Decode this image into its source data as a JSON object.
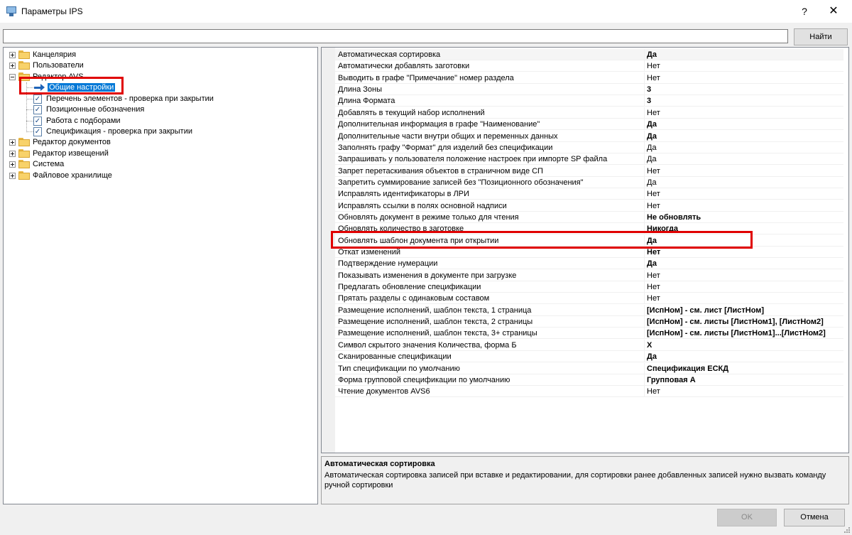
{
  "window": {
    "title": "Параметры IPS",
    "help_label": "?",
    "close_label": "✕"
  },
  "search": {
    "value": "",
    "placeholder": "",
    "button_label": "Найти"
  },
  "tree": {
    "items": [
      {
        "label": "Канцелярия",
        "icon": "folder-icon"
      },
      {
        "label": "Пользователи",
        "icon": "folder-icon"
      },
      {
        "label": "Редактор AVS",
        "icon": "folder-icon"
      },
      {
        "label": "Общие настройки",
        "icon": "arrow-right-icon",
        "selected": true
      },
      {
        "label": "Перечень элементов - проверка при закрытии",
        "icon": "checklist-icon"
      },
      {
        "label": "Позиционные обозначения",
        "icon": "checklist-icon"
      },
      {
        "label": "Работа с подборами",
        "icon": "checklist-icon"
      },
      {
        "label": "Спецификация - проверка при закрытии",
        "icon": "checklist-icon"
      },
      {
        "label": "Редактор документов",
        "icon": "folder-icon"
      },
      {
        "label": "Редактор извещений",
        "icon": "folder-icon"
      },
      {
        "label": "Система",
        "icon": "folder-icon"
      },
      {
        "label": "Файловое хранилище",
        "icon": "folder-icon"
      }
    ]
  },
  "grid": {
    "rows": [
      {
        "name": "Автоматическая сортировка",
        "value": "Да"
      },
      {
        "name": "Автоматически добавлять заготовки",
        "value": "Нет"
      },
      {
        "name": "Выводить в графе \"Примечание\" номер раздела",
        "value": "Нет"
      },
      {
        "name": "Длина Зоны",
        "value": "3"
      },
      {
        "name": "Длина Формата",
        "value": "3"
      },
      {
        "name": "Добавлять в текущий набор исполнений",
        "value": "Нет"
      },
      {
        "name": "Дополнительная информация в графе \"Наименование\"",
        "value": "Да"
      },
      {
        "name": "Дополнительные части внутри общих и переменных данных",
        "value": "Да"
      },
      {
        "name": "Заполнять графу \"Формат\" для изделий без спецификации",
        "value": "Да"
      },
      {
        "name": "Запрашивать у пользователя положение настроек при импорте SP файла",
        "value": "Да"
      },
      {
        "name": "Запрет перетаскивания объектов в страничном виде СП",
        "value": "Нет"
      },
      {
        "name": "Запретить суммирование записей без \"Позиционного обозначения\"",
        "value": "Да"
      },
      {
        "name": "Исправлять идентификаторы в ЛРИ",
        "value": "Нет"
      },
      {
        "name": "Исправлять ссылки в полях основной надписи",
        "value": "Нет"
      },
      {
        "name": "Обновлять документ в режиме только для чтения",
        "value": "Не обновлять"
      },
      {
        "name": "Обновлять количество в заготовке",
        "value": "Никогда"
      },
      {
        "name": "Обновлять шаблон документа при открытии",
        "value": "Да"
      },
      {
        "name": "Откат изменений",
        "value": "Нет"
      },
      {
        "name": "Подтверждение нумерации",
        "value": "Да"
      },
      {
        "name": "Показывать изменения в документе при загрузке",
        "value": "Нет"
      },
      {
        "name": "Предлагать обновление спецификации",
        "value": "Нет"
      },
      {
        "name": "Прятать разделы с одинаковым составом",
        "value": "Нет"
      },
      {
        "name": "Размещение исполнений, шаблон текста, 1 страница",
        "value": "[ИспНом] - см. лист [ЛистНом]"
      },
      {
        "name": "Размещение исполнений, шаблон текста, 2 страницы",
        "value": "[ИспНом] - см. листы [ЛистНом1], [ЛистНом2]"
      },
      {
        "name": "Размещение исполнений, шаблон текста, 3+ страницы",
        "value": "[ИспНом] - см. листы [ЛистНом1]...[ЛистНом2]"
      },
      {
        "name": "Символ скрытого значения Количества, форма Б",
        "value": "X"
      },
      {
        "name": "Сканированные спецификации",
        "value": "Да"
      },
      {
        "name": "Тип спецификации по умолчанию",
        "value": "Спецификация ЕСКД"
      },
      {
        "name": "Форма групповой спецификации по умолчанию",
        "value": "Групповая А"
      },
      {
        "name": "Чтение документов AVS6",
        "value": "Нет"
      }
    ]
  },
  "description": {
    "title": "Автоматическая сортировка",
    "text": "Автоматическая сортировка записей при вставке и редактировании, для сортировки ранее добавленных записей нужно вызвать команду ручной сортировки"
  },
  "buttons": {
    "ok_label": "OK",
    "cancel_label": "Отмена"
  },
  "colors": {
    "selection": "#0078d7",
    "highlight_box": "#e00000"
  }
}
